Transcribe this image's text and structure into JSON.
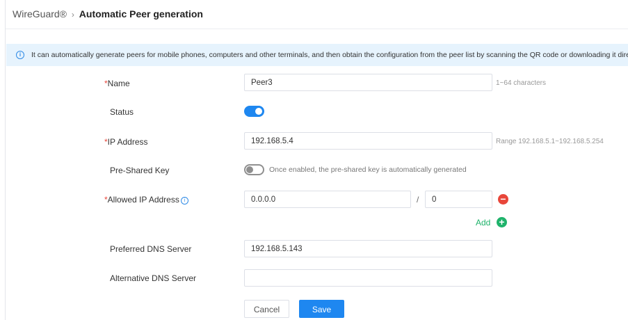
{
  "breadcrumb": {
    "root": "WireGuard®",
    "separator": "›",
    "current": "Automatic Peer generation"
  },
  "info": {
    "icon": "info-icon",
    "text": "It can automatically generate peers for mobile phones, computers and other terminals, and then obtain the configuration from the peer list by scanning the QR code or downloading it direct"
  },
  "form": {
    "required_mark": "*",
    "name": {
      "label": "Name",
      "value": "Peer3",
      "hint": "1~64 characters"
    },
    "status": {
      "label": "Status",
      "enabled": true
    },
    "ip_address": {
      "label": "IP Address",
      "value": "192.168.5.4",
      "hint": "Range 192.168.5.1~192.168.5.254"
    },
    "pre_shared_key": {
      "label": "Pre-Shared Key",
      "enabled": false,
      "hint": "Once enabled, the pre-shared key is automatically generated"
    },
    "allowed_ip": {
      "label": "Allowed IP Address",
      "ip": "0.0.0.0",
      "separator": "/",
      "mask": "0",
      "add_label": "Add"
    },
    "preferred_dns": {
      "label": "Preferred DNS Server",
      "value": "192.168.5.143"
    },
    "alternative_dns": {
      "label": "Alternative DNS Server",
      "value": ""
    }
  },
  "actions": {
    "cancel": "Cancel",
    "save": "Save"
  },
  "colors": {
    "primary": "#1e87f0",
    "danger": "#e8463a",
    "success": "#1fb36b",
    "info_bg": "#e6f3fd"
  }
}
